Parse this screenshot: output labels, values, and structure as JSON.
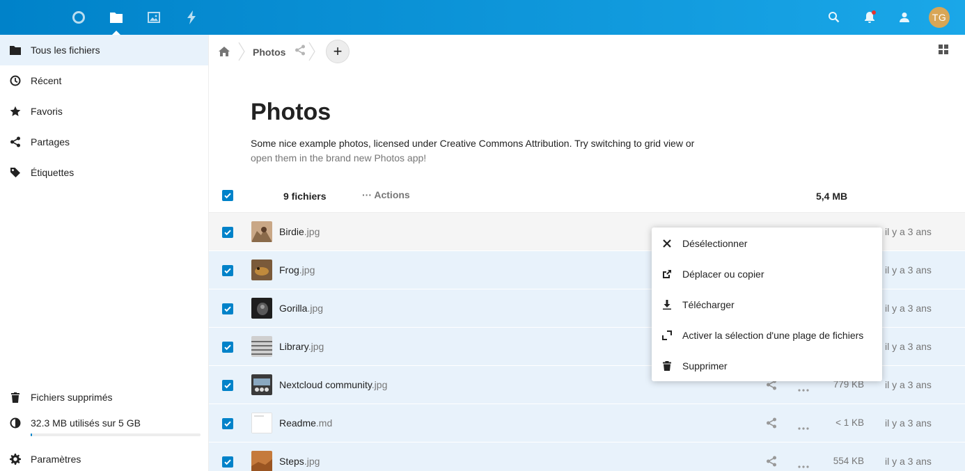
{
  "header": {
    "apps": [
      {
        "name": "dashboard",
        "icon": "circle-icon"
      },
      {
        "name": "files",
        "icon": "folder-icon",
        "active": true
      },
      {
        "name": "photos",
        "icon": "image-icon"
      },
      {
        "name": "activity",
        "icon": "lightning-icon"
      }
    ],
    "avatar_initials": "TG",
    "brand_color_start": "#0082c9",
    "brand_color_end": "#1aa7e8"
  },
  "sidebar": {
    "items": [
      {
        "label": "Tous les fichiers",
        "icon": "folder-icon",
        "active": true
      },
      {
        "label": "Récent",
        "icon": "clock-icon"
      },
      {
        "label": "Favoris",
        "icon": "star-icon"
      },
      {
        "label": "Partages",
        "icon": "share-icon"
      },
      {
        "label": "Étiquettes",
        "icon": "tag-icon"
      }
    ],
    "trash_label": "Fichiers supprimés",
    "quota_label": "32.3 MB utilisés sur 5 GB",
    "quota_fraction": 0.0065,
    "settings_label": "Paramètres"
  },
  "breadcrumb": {
    "current": "Photos"
  },
  "folder": {
    "title": "Photos",
    "description_main": "Some nice example photos, licensed under Creative Commons Attribution. Try switching to grid view or",
    "description_more": "open them in the brand new Photos app!"
  },
  "list_header": {
    "count": "9 fichiers",
    "actions_label": "Actions",
    "total_size": "5,4 MB"
  },
  "files": [
    {
      "base": "Birdie",
      "ext": ".jpg",
      "size": "",
      "date": "il y a 3 ans"
    },
    {
      "base": "Frog",
      "ext": ".jpg",
      "size": "",
      "date": "il y a 3 ans"
    },
    {
      "base": "Gorilla",
      "ext": ".jpg",
      "size": "",
      "date": "il y a 3 ans"
    },
    {
      "base": "Library",
      "ext": ".jpg",
      "size": "",
      "date": "il y a 3 ans"
    },
    {
      "base": "Nextcloud community",
      "ext": ".jpg",
      "size": "779 KB",
      "date": "il y a 3 ans"
    },
    {
      "base": "Readme",
      "ext": ".md",
      "size": "< 1 KB",
      "date": "il y a 3 ans"
    },
    {
      "base": "Steps",
      "ext": ".jpg",
      "size": "554 KB",
      "date": "il y a 3 ans"
    }
  ],
  "menu": {
    "items": [
      {
        "label": "Désélectionner",
        "icon": "close-icon"
      },
      {
        "label": "Déplacer ou copier",
        "icon": "external-move-icon"
      },
      {
        "label": "Télécharger",
        "icon": "download-icon"
      },
      {
        "label": "Activer la sélection d'une plage de fichiers",
        "icon": "range-select-icon"
      },
      {
        "label": "Supprimer",
        "icon": "trash-icon"
      }
    ]
  }
}
